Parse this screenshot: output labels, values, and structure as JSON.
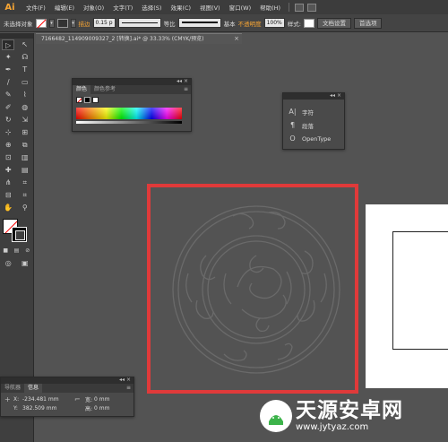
{
  "app": {
    "logo_text": "Ai"
  },
  "menu": {
    "items": [
      "文件(F)",
      "编辑(E)",
      "对象(O)",
      "文字(T)",
      "选择(S)",
      "效果(C)",
      "视图(V)",
      "窗口(W)",
      "帮助(H)"
    ]
  },
  "control_bar": {
    "selection_label": "未选择对象",
    "stroke_label": "描边",
    "stroke_value": "0.15 p",
    "profile_label": "等比",
    "brush_label": "基本",
    "opacity_label": "不透明度",
    "opacity_value": "100%",
    "style_label": "样式:",
    "doc_setup_button": "文档设置",
    "prefs_button": "首选项"
  },
  "document": {
    "tab_title": "7166482_114909009327_2 [转换].ai* @ 33.33% (CMYK/预览)",
    "close_glyph": "×"
  },
  "tools": [
    [
      "▷",
      "↖"
    ],
    [
      "✦",
      "☊"
    ],
    [
      "✒",
      "T"
    ],
    [
      "∕",
      "▭"
    ],
    [
      "✎",
      "⌇"
    ],
    [
      "✐",
      "◍"
    ],
    [
      "↻",
      "⇲"
    ],
    [
      "⊹",
      "⊞"
    ],
    [
      "⊕",
      "⧉"
    ],
    [
      "⊡",
      "▥"
    ],
    [
      "✚",
      "▤"
    ],
    [
      "⋔",
      "⌗"
    ],
    [
      "✋",
      "🔍"
    ]
  ],
  "color_panel": {
    "tabs": [
      "颜色",
      "颜色参考"
    ],
    "menu_glyph": "≡"
  },
  "type_panel": {
    "items": [
      {
        "icon": "A|",
        "label": "字符"
      },
      {
        "icon": "¶",
        "label": "段落"
      },
      {
        "icon": "O",
        "label": "OpenType"
      }
    ]
  },
  "info_panel": {
    "tabs": [
      "导航器",
      "信息"
    ],
    "x_label": "X:",
    "x_value": "-234.481 mm",
    "y_label": "Y:",
    "y_value": "382.509 mm",
    "w_label": "宽:",
    "w_value": "0 mm",
    "h_label": "高:",
    "h_value": "0 mm"
  },
  "watermark": {
    "title": "天源安卓网",
    "url": "www.jytyaz.com"
  },
  "colors": {
    "highlight": "#e03a3a",
    "accent_orange": "#f7a534"
  }
}
